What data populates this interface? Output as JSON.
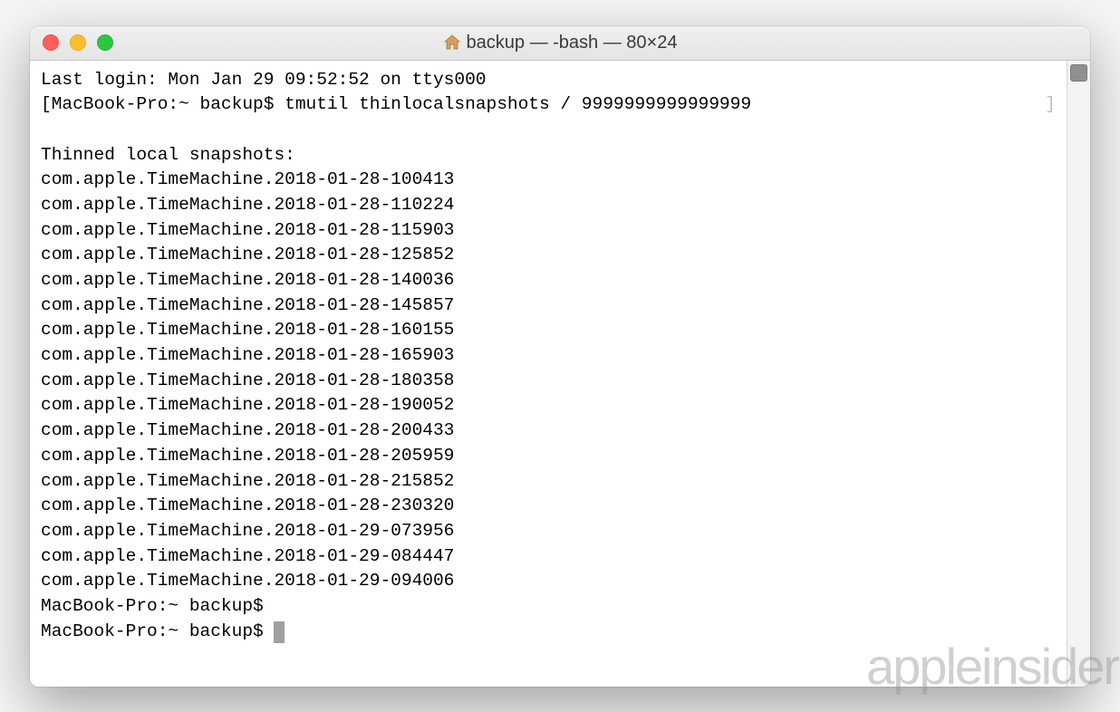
{
  "window": {
    "title": "backup — -bash — 80×24"
  },
  "terminal": {
    "last_login": "Last login: Mon Jan 29 09:52:52 on ttys000",
    "prompt_prefix": "MacBook-Pro:~ backup$",
    "command": "tmutil thinlocalsnapshots / 9999999999999999",
    "output_header": "Thinned local snapshots:",
    "snapshots": [
      "com.apple.TimeMachine.2018-01-28-100413",
      "com.apple.TimeMachine.2018-01-28-110224",
      "com.apple.TimeMachine.2018-01-28-115903",
      "com.apple.TimeMachine.2018-01-28-125852",
      "com.apple.TimeMachine.2018-01-28-140036",
      "com.apple.TimeMachine.2018-01-28-145857",
      "com.apple.TimeMachine.2018-01-28-160155",
      "com.apple.TimeMachine.2018-01-28-165903",
      "com.apple.TimeMachine.2018-01-28-180358",
      "com.apple.TimeMachine.2018-01-28-190052",
      "com.apple.TimeMachine.2018-01-28-200433",
      "com.apple.TimeMachine.2018-01-28-205959",
      "com.apple.TimeMachine.2018-01-28-215852",
      "com.apple.TimeMachine.2018-01-28-230320",
      "com.apple.TimeMachine.2018-01-29-073956",
      "com.apple.TimeMachine.2018-01-29-084447",
      "com.apple.TimeMachine.2018-01-29-094006"
    ]
  },
  "watermark": "appleinsider"
}
